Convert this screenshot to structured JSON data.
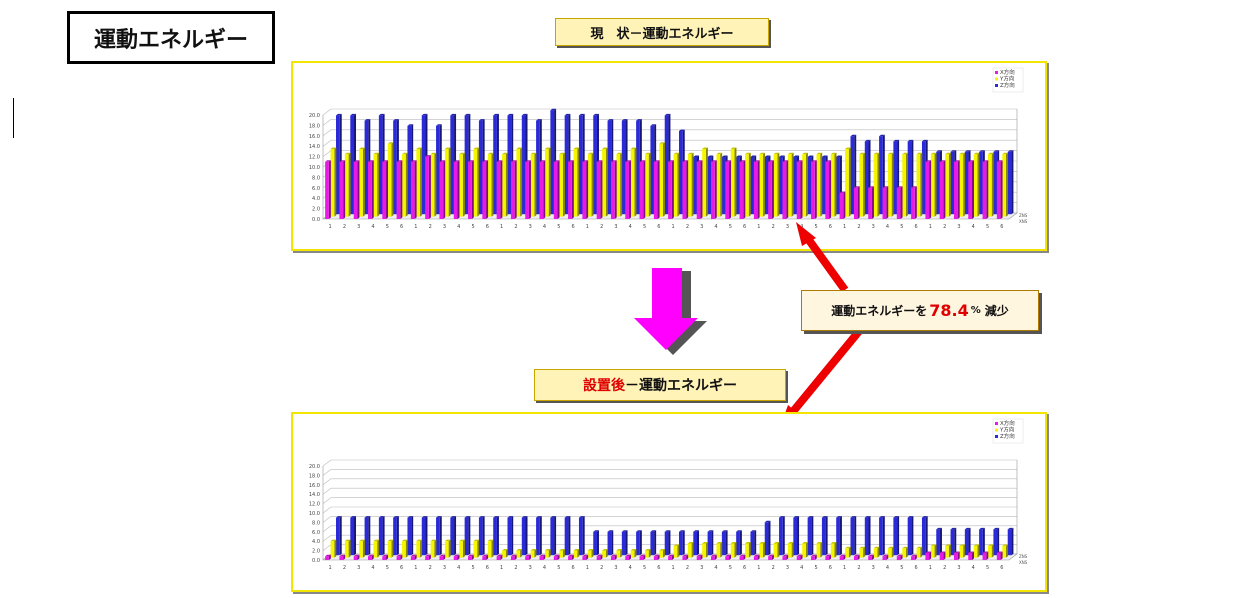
{
  "page_title": "運動エネルギー",
  "top_label": "現　状－運動エネルギー",
  "bottom_label": {
    "red": "設置後",
    "rest": "－運動エネルギー"
  },
  "callout": {
    "prefix": "運動エネルギーを",
    "value": "78.4",
    "unit": "%",
    "suffix": "減少"
  },
  "colors": {
    "x": "#e81ae8",
    "y": "#f5f500",
    "z": "#2a2ad8",
    "arrow_down": "#ff00ff",
    "arrow_red": "#ee0000"
  },
  "chart_data": [
    {
      "type": "bar",
      "ylim": [
        0,
        20
      ],
      "yticks": [
        "0.0",
        "2.0",
        "4.0",
        "6.0",
        "8.0",
        "10.0",
        "12.0",
        "14.0",
        "16.0",
        "18.0",
        "20.0"
      ],
      "categories": [
        "1",
        "2",
        "3",
        "4",
        "5",
        "6",
        "1",
        "2",
        "3",
        "4",
        "5",
        "6",
        "1",
        "2",
        "3",
        "4",
        "5",
        "6",
        "1",
        "2",
        "3",
        "4",
        "5",
        "6",
        "1",
        "2",
        "3",
        "4",
        "5",
        "6",
        "1",
        "2",
        "3",
        "4",
        "5",
        "6",
        "1",
        "2",
        "3",
        "4",
        "5",
        "6",
        "1",
        "2",
        "3",
        "4",
        "5",
        "6"
      ],
      "legend": [
        "X方向",
        "Y方向",
        "Z方向"
      ],
      "depth_labels": [
        "ZNS",
        "XNS"
      ],
      "series": [
        {
          "name": "X方向",
          "values": [
            11,
            11,
            11,
            11,
            11,
            11,
            11,
            12,
            11,
            11,
            11,
            11,
            11,
            11,
            11,
            11,
            11,
            11,
            11,
            11,
            11,
            11,
            11,
            11,
            11,
            11,
            11,
            11,
            11,
            11,
            11,
            11,
            11,
            11,
            11,
            11,
            5,
            6,
            6,
            6,
            6,
            6,
            11,
            11,
            11,
            11,
            11,
            11
          ]
        },
        {
          "name": "Y方向",
          "values": [
            13,
            12,
            13,
            12,
            14,
            12,
            13,
            12,
            13,
            12,
            13,
            12,
            12,
            13,
            12,
            13,
            12,
            13,
            12,
            13,
            12,
            13,
            12,
            14,
            12,
            12,
            13,
            12,
            13,
            12,
            12,
            12,
            12,
            12,
            12,
            12,
            13,
            12,
            12,
            12,
            12,
            12,
            12,
            12,
            12,
            12,
            12,
            12
          ]
        },
        {
          "name": "Z方向",
          "values": [
            19,
            19,
            18,
            19,
            18,
            17,
            19,
            17,
            19,
            19,
            18,
            19,
            19,
            19,
            18,
            20,
            19,
            19,
            19,
            18,
            18,
            18,
            17,
            19,
            16,
            11,
            11,
            11,
            11,
            11,
            11,
            11,
            11,
            11,
            11,
            11,
            15,
            14,
            15,
            14,
            14,
            14,
            12,
            12,
            12,
            12,
            12,
            12
          ]
        }
      ]
    },
    {
      "type": "bar",
      "ylim": [
        0,
        20
      ],
      "yticks": [
        "0.0",
        "2.0",
        "4.0",
        "6.0",
        "8.0",
        "10.0",
        "12.0",
        "14.0",
        "16.0",
        "18.0",
        "20.0"
      ],
      "categories": [
        "1",
        "2",
        "3",
        "4",
        "5",
        "6",
        "1",
        "2",
        "3",
        "4",
        "5",
        "6",
        "1",
        "2",
        "3",
        "4",
        "5",
        "6",
        "1",
        "2",
        "3",
        "4",
        "5",
        "6",
        "1",
        "2",
        "3",
        "4",
        "5",
        "6",
        "1",
        "2",
        "3",
        "4",
        "5",
        "6",
        "1",
        "2",
        "3",
        "4",
        "5",
        "6",
        "1",
        "2",
        "3",
        "4",
        "5",
        "6"
      ],
      "legend": [
        "X方向",
        "Y方向",
        "Z方向"
      ],
      "depth_labels": [
        "ZNS",
        "XNS"
      ],
      "series": [
        {
          "name": "X方向",
          "values": [
            0.8,
            0.8,
            0.8,
            0.8,
            0.8,
            0.8,
            0.8,
            0.8,
            0.8,
            0.8,
            0.8,
            0.8,
            0.8,
            0.8,
            0.8,
            0.8,
            0.8,
            0.8,
            0.8,
            0.8,
            0.8,
            0.8,
            0.8,
            0.8,
            0.8,
            0.8,
            0.8,
            0.8,
            0.8,
            0.8,
            0.8,
            0.8,
            0.8,
            0.8,
            0.8,
            0.8,
            0.8,
            0.8,
            0.8,
            0.8,
            0.8,
            0.8,
            1.5,
            1.5,
            1.5,
            1.5,
            1.5,
            1.5
          ]
        },
        {
          "name": "Y方向",
          "values": [
            3.5,
            3.5,
            3.5,
            3.5,
            3.5,
            3.5,
            3.5,
            3.5,
            3.5,
            3.5,
            3.5,
            3.5,
            1.5,
            1.5,
            1.5,
            1.5,
            1.5,
            1.5,
            1.5,
            1.5,
            1.5,
            1.5,
            1.5,
            1.5,
            2.5,
            3,
            3,
            3,
            3,
            3,
            3,
            3,
            3,
            3,
            3,
            3,
            2,
            2,
            2,
            2,
            2,
            2,
            2.5,
            2.5,
            2.5,
            2.5,
            2.5,
            2.5
          ]
        },
        {
          "name": "Z方向",
          "values": [
            8,
            8,
            8,
            8,
            8,
            8,
            8,
            8,
            8,
            8,
            8,
            8,
            8,
            8,
            8,
            8,
            8,
            8,
            5,
            5,
            5,
            5,
            5,
            5,
            5,
            5,
            5,
            5,
            5,
            5,
            7,
            8,
            8,
            8,
            8,
            8,
            8,
            8,
            8,
            8,
            8,
            8,
            5.5,
            5.5,
            5.5,
            5.5,
            5.5,
            5.5
          ]
        }
      ]
    }
  ]
}
